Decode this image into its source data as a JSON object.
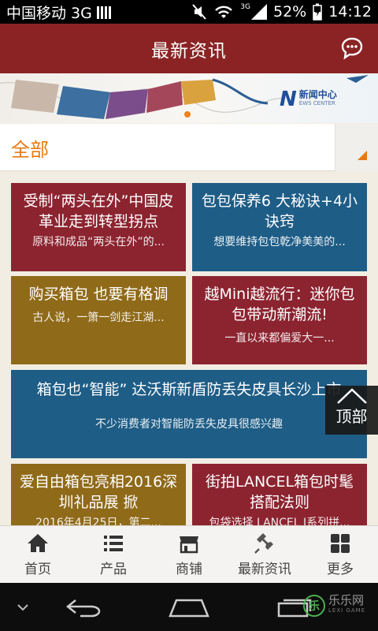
{
  "status": {
    "carrier": "中国移动 3G",
    "net_badge": "3G",
    "battery": "52%",
    "time": "14:12"
  },
  "header": {
    "title": "最新资讯",
    "chat_icon": "chat-bubble-icon"
  },
  "banner": {
    "logo_letter": "N",
    "logo_cn": "新闻中心",
    "logo_en": "EWS CENTER"
  },
  "filter": {
    "selected": "全部"
  },
  "articles": [
    {
      "title": "受制“两头在外”中国皮革业走到转型拐点",
      "summary": "原料和成品“两头在外”的...",
      "color": "#8c2430"
    },
    {
      "title": "包包保养6 大秘诀+4小诀窍",
      "summary": "想要维持包包乾净美美的...",
      "color": "#1e5d86"
    },
    {
      "title": "购买箱包 也要有格调",
      "summary": "古人说，一箫一剑走江湖...",
      "color": "#8f6a19"
    },
    {
      "title": "越Mini越流行：迷你包包带动新潮流!",
      "summary": "一直以来都偏爱大一...",
      "color": "#8c2430"
    },
    {
      "title": "箱包也“智能” 达沃斯新盾防丢失皮具长沙上市",
      "summary": "不少消费者对智能防丢失皮具很感兴趣",
      "color": "#1e5d86"
    },
    {
      "title": "爱自由箱包亮相2016深圳礼品展 掀",
      "summary": "2016年4月25日，第二...",
      "color": "#8f6a19"
    },
    {
      "title": "街拍LANCEL箱包时髦搭配法则",
      "summary": "包袋选择 LANCEL I系列拼...",
      "color": "#8c2430"
    }
  ],
  "back_to_top": "顶部",
  "tabs": [
    {
      "label": "首页",
      "icon": "home-icon"
    },
    {
      "label": "产品",
      "icon": "list-icon"
    },
    {
      "label": "商铺",
      "icon": "shop-icon"
    },
    {
      "label": "最新资讯",
      "icon": "news-pin-icon"
    },
    {
      "label": "更多",
      "icon": "grid-icon"
    }
  ],
  "watermark": {
    "cn": "乐乐网",
    "en": "LEXI GAME"
  }
}
